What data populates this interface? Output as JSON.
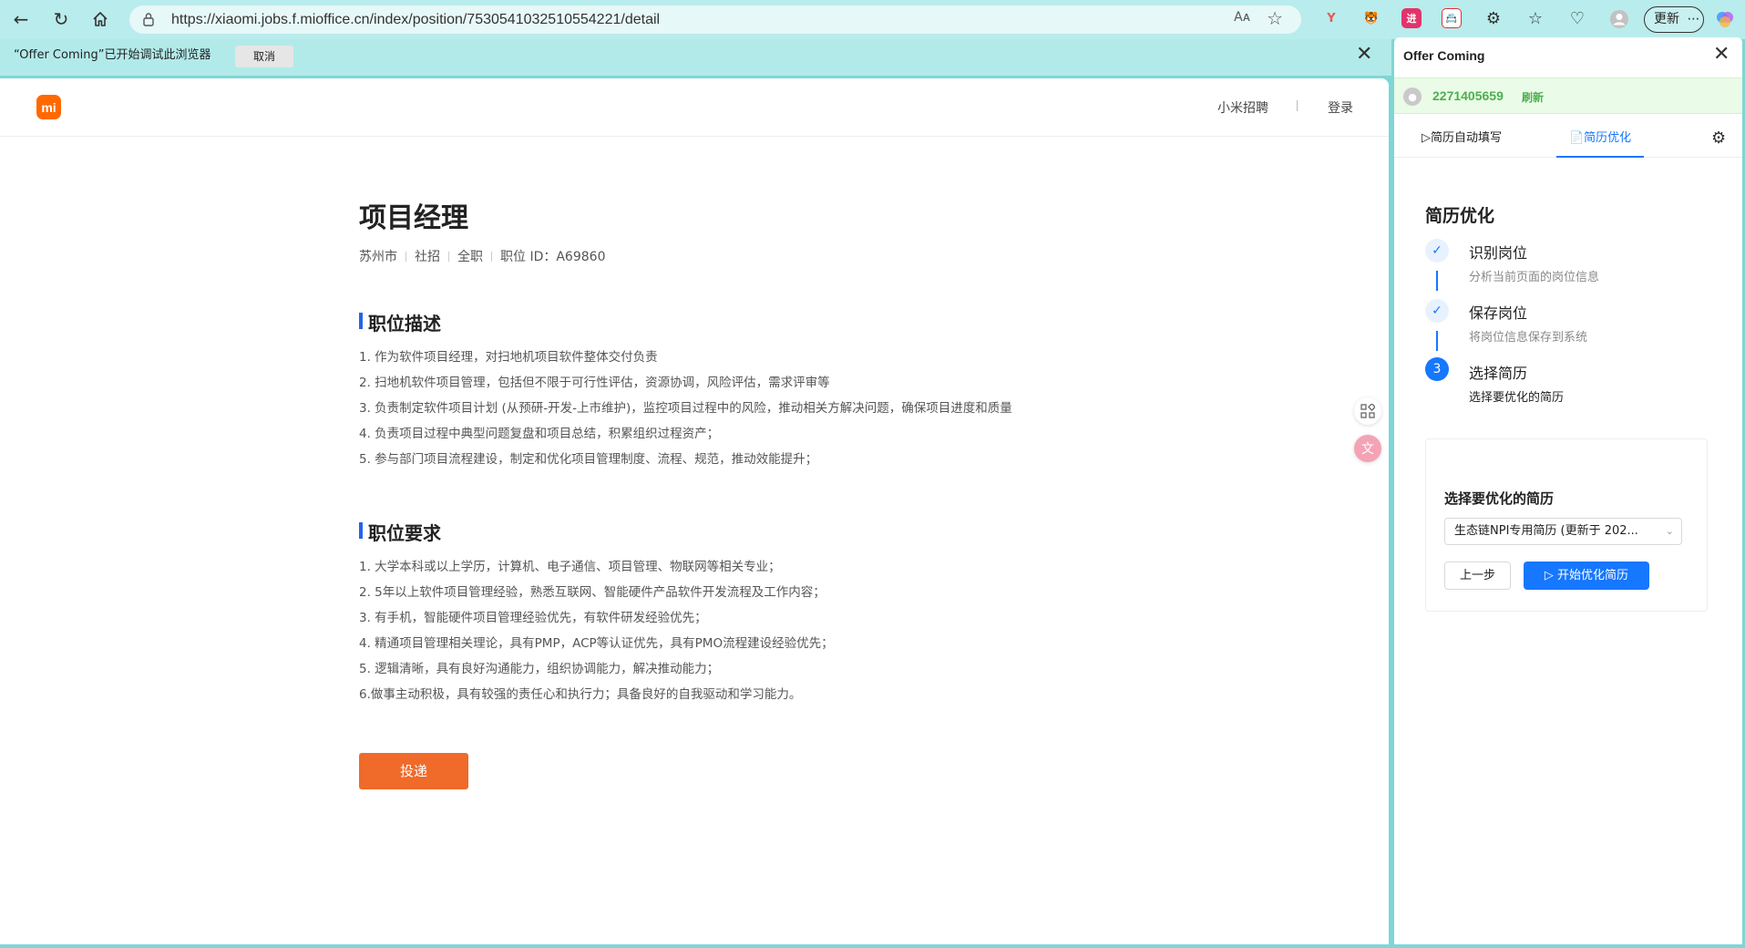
{
  "browser": {
    "url": "https://xiaomi.jobs.f.mioffice.cn/index/position/7530541032510554221/detail",
    "read_aloud": "Aᴀ",
    "update_label": "更新",
    "more": "⋯",
    "extensions": [
      "Y",
      "🐯",
      "进",
      "📇"
    ]
  },
  "infobar": {
    "message": "“Offer Coming”已开始调试此浏览器",
    "cancel_label": "取消",
    "close": "✕"
  },
  "site": {
    "logo_text": "mi",
    "nav": {
      "recruit": "小米招聘",
      "login": "登录"
    }
  },
  "job": {
    "title": "项目经理",
    "meta": [
      "苏州市",
      "社招",
      "全职",
      "职位 ID：A69860"
    ],
    "description_heading": "职位描述",
    "description": [
      "1. 作为软件项目经理，对扫地机项目软件整体交付负责",
      "2. 扫地机软件项目管理，包括但不限于可行性评估，资源协调，风险评估，需求评审等",
      "3. 负责制定软件项目计划 (从预研-开发-上市维护)，监控项目过程中的风险，推动相关方解决问题，确保项目进度和质量",
      "4. 负责项目过程中典型问题复盘和项目总结，积累组织过程资产；",
      "5. 参与部门项目流程建设，制定和优化项目管理制度、流程、规范，推动效能提升；"
    ],
    "requirements_heading": "职位要求",
    "requirements": [
      "1. 大学本科或以上学历，计算机、电子通信、项目管理、物联网等相关专业；",
      "2. 5年以上软件项目管理经验，熟悉互联网、智能硬件产品软件开发流程及工作内容；",
      "3. 有手机，智能硬件项目管理经验优先，有软件研发经验优先；",
      "4. 精通项目管理相关理论，具有PMP，ACP等认证优先，具有PMO流程建设经验优先；",
      "5. 逻辑清晰，具有良好沟通能力，组织协调能力，解决推动能力；",
      "6.做事主动积极，具有较强的责任心和执行力；具备良好的自我驱动和学习能力。"
    ],
    "apply_label": "投递"
  },
  "panel": {
    "title": "Offer Coming",
    "user_id": "2271405659",
    "refresh_label": "刷新",
    "tabs": {
      "autofill": "▷简历自动填写",
      "optimize": "📄简历优化"
    },
    "heading": "简历优化",
    "steps": [
      {
        "title": "识别岗位",
        "desc": "分析当前页面的岗位信息",
        "mark": "✓"
      },
      {
        "title": "保存岗位",
        "desc": "将岗位信息保存到系统",
        "mark": "✓"
      },
      {
        "title": "选择简历",
        "desc": "选择要优化的简历",
        "mark": "3"
      }
    ],
    "card": {
      "title": "选择要优化的简历",
      "selected_resume": "生态链NPI专用简历 (更新于 202...",
      "prev_label": "上一步",
      "start_label": "▷ 开始优化简历"
    }
  },
  "colors": {
    "browser_frame": "#7fd6d6",
    "brand_orange": "#ff6900",
    "apply_button": "#f06a2a",
    "accent_blue": "#1677ff",
    "user_green": "#4caf50"
  },
  "icons": [
    "back-icon",
    "reload-icon",
    "home-icon",
    "lock-icon",
    "star-icon",
    "close-icon",
    "qr-icon",
    "translate-icon",
    "gear-icon",
    "avatar-icon",
    "check-icon"
  ]
}
